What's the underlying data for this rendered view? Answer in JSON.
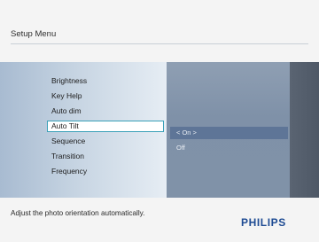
{
  "header": {
    "title": "Setup Menu"
  },
  "menu": {
    "items": [
      {
        "label": "Brightness"
      },
      {
        "label": "Key Help"
      },
      {
        "label": "Auto dim"
      },
      {
        "label": "Auto Tilt"
      },
      {
        "label": "Sequence"
      },
      {
        "label": "Transition"
      },
      {
        "label": "Frequency"
      }
    ],
    "selected_index": 3
  },
  "options": {
    "items": [
      {
        "label": "< On >"
      },
      {
        "label": "Off"
      }
    ],
    "active_index": 0
  },
  "footer": {
    "help_text": "Adjust the photo orientation automatically.",
    "brand": "PHILIPS"
  },
  "colors": {
    "accent": "#3aa0b8",
    "brand": "#1e4b93"
  }
}
